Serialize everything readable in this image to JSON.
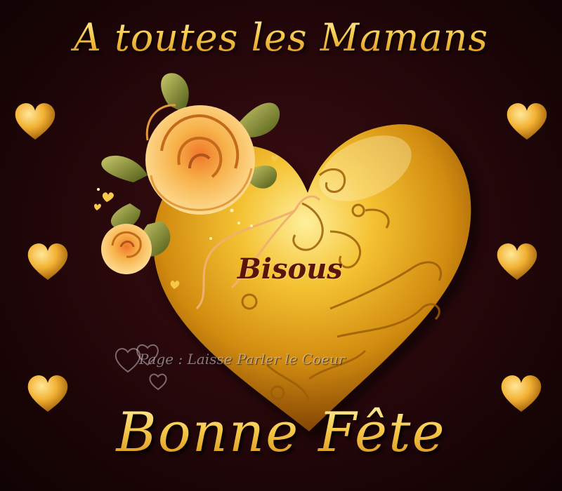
{
  "card": {
    "title": "A toutes les Mamans",
    "heart_text": "Bisous",
    "watermark": "Page : Laisse Parler le Coeur",
    "footer": "Bonne Fête"
  },
  "colors": {
    "background": "#1a0608",
    "gold": "#f6c23f",
    "gold_dark": "#b87510",
    "rose": "#f3b04a",
    "leaf": "#7c8a2e",
    "bisous_text": "#5a1408"
  },
  "icons": [
    "gold-heart-icon",
    "golden-rose-icon",
    "leaf-icon",
    "ribbon-icon",
    "filigree-swirl-icon"
  ]
}
